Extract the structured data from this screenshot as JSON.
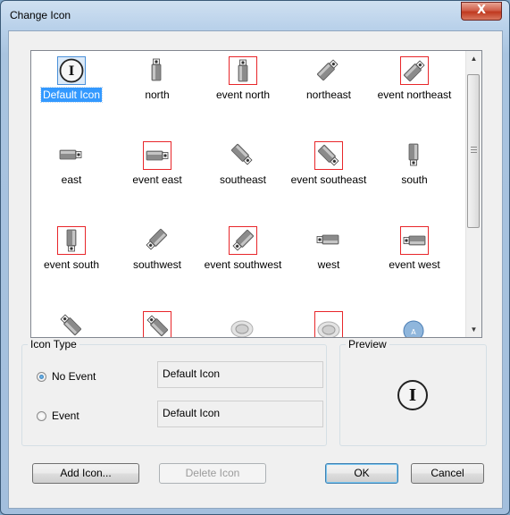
{
  "window": {
    "title": "Change Icon",
    "close_glyph": "X"
  },
  "icons": [
    {
      "label": "Default Icon",
      "icon": "default-info-icon",
      "event": false,
      "selected": true
    },
    {
      "label": "north",
      "icon": "camera-north-icon",
      "event": false
    },
    {
      "label": "event north",
      "icon": "camera-north-icon",
      "event": true
    },
    {
      "label": "northeast",
      "icon": "camera-northeast-icon",
      "event": false
    },
    {
      "label": "event northeast",
      "icon": "camera-northeast-icon",
      "event": true
    },
    {
      "label": "east",
      "icon": "camera-east-icon",
      "event": false
    },
    {
      "label": "event east",
      "icon": "camera-east-icon",
      "event": true
    },
    {
      "label": "southeast",
      "icon": "camera-southeast-icon",
      "event": false
    },
    {
      "label": "event southeast",
      "icon": "camera-southeast-icon",
      "event": true
    },
    {
      "label": "south",
      "icon": "camera-south-icon",
      "event": false
    },
    {
      "label": "event south",
      "icon": "camera-south-icon",
      "event": true
    },
    {
      "label": "southwest",
      "icon": "camera-southwest-icon",
      "event": false
    },
    {
      "label": "event southwest",
      "icon": "camera-southwest-icon",
      "event": true
    },
    {
      "label": "west",
      "icon": "camera-west-icon",
      "event": false
    },
    {
      "label": "event west",
      "icon": "camera-west-icon",
      "event": true
    },
    {
      "label": "",
      "icon": "camera-northwest-icon",
      "event": false
    },
    {
      "label": "",
      "icon": "camera-northwest-icon",
      "event": true
    },
    {
      "label": "",
      "icon": "dome-camera-icon",
      "event": false
    },
    {
      "label": "",
      "icon": "dome-camera-icon",
      "event": true
    },
    {
      "label": "",
      "icon": "ptz-camera-icon",
      "event": false
    }
  ],
  "icon_type": {
    "title": "Icon Type",
    "no_event_label": "No Event",
    "no_event_value": "Default Icon",
    "event_label": "Event",
    "event_value": "Default Icon",
    "selected": "no_event"
  },
  "preview": {
    "title": "Preview",
    "glyph": "I"
  },
  "buttons": {
    "add_icon": "Add Icon...",
    "delete_icon": "Delete Icon",
    "ok": "OK",
    "cancel": "Cancel"
  },
  "colors": {
    "event_border": "#e8262a",
    "selection": "#3399ff"
  }
}
